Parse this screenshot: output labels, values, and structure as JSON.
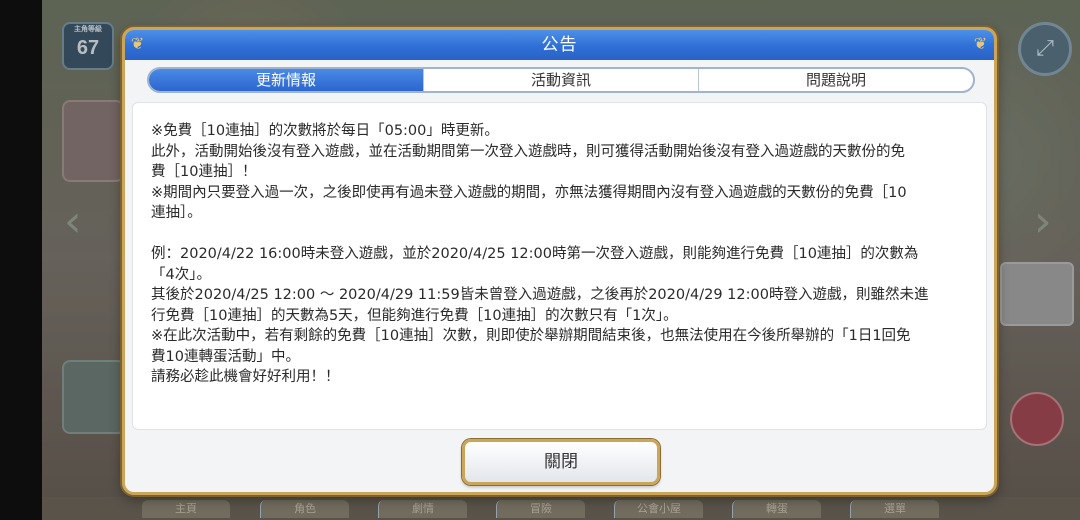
{
  "game_background": {
    "level_badge_label": "主角等級",
    "level_value": "67",
    "bottom_tabs": [
      "主頁",
      "角色",
      "劇情",
      "冒險",
      "公會小屋",
      "轉蛋",
      "選單"
    ]
  },
  "dialog": {
    "title": "公告",
    "tabs": [
      {
        "label": "更新情報",
        "active": true
      },
      {
        "label": "活動資訊",
        "active": false
      },
      {
        "label": "問題說明",
        "active": false
      }
    ],
    "lines": [
      "※免費［10連抽］的次數將於每日「05:00」時更新。",
      "此外，活動開始後沒有登入遊戲，並在活動期間第一次登入遊戲時，則可獲得活動開始後沒有登入過遊戲的天數份的免",
      "費［10連抽］！",
      "※期間內只要登入過一次，之後即使再有過未登入遊戲的期間，亦無法獲得期間內沒有登入過遊戲的天數份的免費［10",
      "連抽］。",
      "",
      "例：2020/4/22 16:00時未登入遊戲，並於2020/4/25 12:00時第一次登入遊戲，則能夠進行免費［10連抽］的次數為",
      "「4次」。",
      "其後於2020/4/25 12:00 ～ 2020/4/29 11:59皆未曾登入過遊戲，之後再於2020/4/29 12:00時登入遊戲，則雖然未進",
      "行免費［10連抽］的天數為5天，但能夠進行免費［10連抽］的次數只有「1次」。",
      "※在此次活動中，若有剩餘的免費［10連抽］次數，則即使於舉辦期間結束後，也無法使用在今後所舉辦的「1日1回免",
      "費10連轉蛋活動」中。",
      "請務必趁此機會好好利用！！"
    ],
    "close_label": "關閉"
  },
  "colors": {
    "title_bar": "#2f6fd6",
    "frame_gold": "#c9a65a",
    "tab_active": "#2c66cf"
  }
}
